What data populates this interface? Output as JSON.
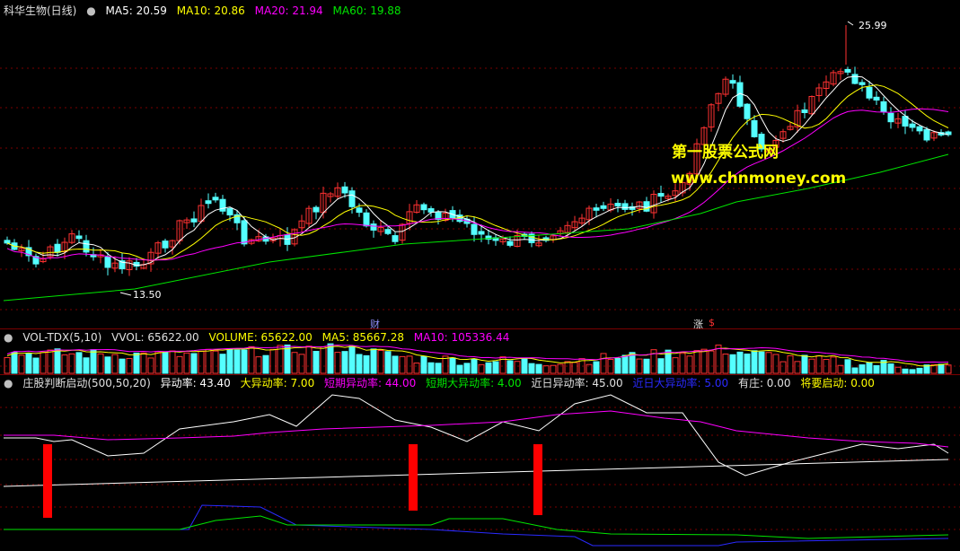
{
  "main_legend": {
    "stock_name": "科华生物(日线)",
    "ma5": "MA5: 20.59",
    "ma10": "MA10: 20.86",
    "ma20": "MA20: 21.94",
    "ma60": "MA60: 19.88"
  },
  "price_annotations": {
    "high": "25.99",
    "low": "13.50"
  },
  "event_markers": {
    "finance": "财",
    "limit_up": "涨",
    "dividend": "$"
  },
  "watermark": {
    "line1": "第一股票公式网",
    "line2": "www.chnmoney.com"
  },
  "volume_legend": {
    "name": "VOL-TDX(5,10)",
    "vvol": "VVOL: 65622.00",
    "volume": "VOLUME: 65622.00",
    "ma5": "MA5: 85667.28",
    "ma10": "MA10: 105336.44"
  },
  "indicator_legend": {
    "name": "庄股判断启动(500,50,20)",
    "items": [
      "异动率: 43.40",
      "大异动率: 7.00",
      "短期异动率: 44.00",
      "短期大异动率: 4.00",
      "近日异动率: 45.00",
      "近日大异动率: 5.00",
      "有庄: 0.00",
      "将要启动: 0.00"
    ]
  },
  "colors": {
    "up": "#ff3232",
    "down": "#54ffff",
    "ma5": "#ffffff",
    "ma10": "#ffff00",
    "ma20": "#ff00ff",
    "ma60": "#00e600",
    "grid": "#7a0000",
    "signal": "#ff0000"
  },
  "chart_data": [
    {
      "type": "candlestick",
      "title": "科华生物(日线)",
      "ylim": [
        12.5,
        27
      ],
      "price_high": 25.99,
      "price_low": 13.5,
      "series": [
        {
          "name": "MA5",
          "last": 20.59
        },
        {
          "name": "MA10",
          "last": 20.86
        },
        {
          "name": "MA20",
          "last": 21.94
        },
        {
          "name": "MA60",
          "last": 19.88
        }
      ]
    },
    {
      "type": "bar",
      "title": "VOL-TDX(5,10)",
      "series": [
        {
          "name": "VVOL",
          "last": 65622.0
        },
        {
          "name": "VOLUME",
          "last": 65622.0
        },
        {
          "name": "MA5",
          "last": 85667.28
        },
        {
          "name": "MA10",
          "last": 105336.44
        }
      ]
    },
    {
      "type": "line",
      "title": "庄股判断启动(500,50,20)",
      "series": [
        {
          "name": "异动率",
          "last": 43.4
        },
        {
          "name": "大异动率",
          "last": 7.0
        },
        {
          "name": "短期异动率",
          "last": 44.0
        },
        {
          "name": "短期大异动率",
          "last": 4.0
        },
        {
          "name": "近日异动率",
          "last": 45.0
        },
        {
          "name": "近日大异动率",
          "last": 5.0
        },
        {
          "name": "有庄",
          "last": 0.0
        },
        {
          "name": "将要启动",
          "last": 0.0
        }
      ]
    }
  ]
}
